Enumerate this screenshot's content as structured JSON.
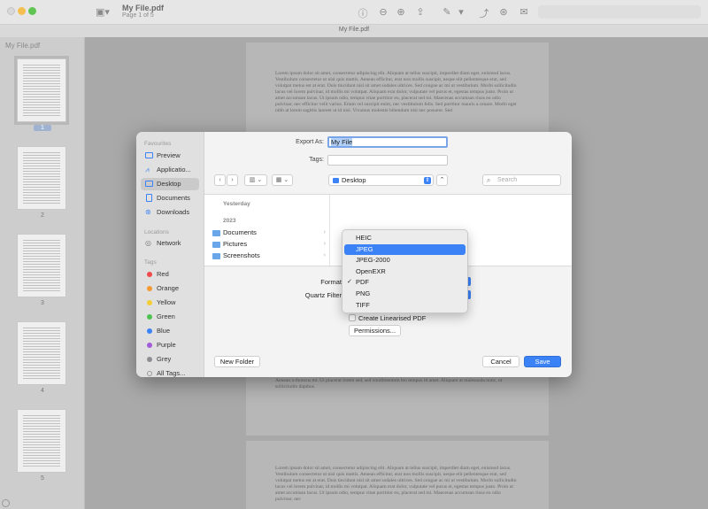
{
  "window": {
    "doc_title": "My File.pdf",
    "doc_subtitle": "Page 1 of 5",
    "tab_title": "My File.pdf"
  },
  "thumbnails": {
    "title": "My File.pdf",
    "pages": [
      "1",
      "2",
      "3",
      "4",
      "5"
    ]
  },
  "document": {
    "page1_text": "Lorem ipsum dolor sit amet, consectetur adipiscing elit. Aliquam at tellus suscipit, imperdiet diam eget, euismod lacus. Vestibulum consectetur ut nisl quis mattis. Aenean efficitur, erat non mollis suscipit, neque elit pellentesque erat, sed volutpat metus est at erat. Duis tincidunt nisl sit amet sodales ultrices. Sed congue ac mi ut vestibulum. Morbi sollicitudin lacus vel lorem pulvinar, id mollis mi volutpat. Aliquam erat dolor, vulputate vel purus et, egestas tempus justo. Proin ut amet accumsan lacus. Ut ipsum odio, tempus vitae porttitor eu, placerat sed mi. Maecenas accumsan risus eu odio pulvinar, nec efficitur velit varius. Etiam vel suscipit enim, nec vestibulum felis. Sed porttitor mauris a ornare. Morbi eget nibh at lorem sagittis laoreet ut id nisi. Vivamus molestie bibendum nisl nec posuere. Sed",
    "page1_lower_text": "Aenean a rhoncus mi. Ut placerat lorem sed, sed condimentum leo tempus id amet. Aliquam at malesuada nunc, ut sollicitudin dapibus.",
    "page2_text": "Lorem ipsum dolor sit amet, consectetur adipiscing elit. Aliquam at tellus suscipit, imperdiet diam eget, euismod lacus. Vestibulum consectetur ut nisl quis mattis. Aenean efficitur, erat non mollis suscipit, neque elit pellentesque erat, sed volutpat metus est at erat. Duis tincidunt nisl sit amet sodales ultrices. Sed congue ac mi ut vestibulum. Morbi sollicitudin lacus vel lorem pulvinar, id mollis mi volutpat. Aliquam erat dolor, vulputate vel purus et, egestas tempus justo. Proin ut amet accumsan lacus. Ut ipsum odio, tempus vitae porttitor eu, placerat sed mi. Maecenas accumsan risus eu odio pulvinar, nec"
  },
  "dialog": {
    "sidebar": {
      "favourites_heading": "Favourites",
      "favourites": [
        {
          "label": "Preview",
          "icon": "preview-icon"
        },
        {
          "label": "Applicatio...",
          "icon": "applications-icon"
        },
        {
          "label": "Desktop",
          "icon": "desktop-icon"
        },
        {
          "label": "Documents",
          "icon": "document-icon"
        },
        {
          "label": "Downloads",
          "icon": "download-icon"
        }
      ],
      "locations_heading": "Locations",
      "locations": [
        {
          "label": "Network",
          "icon": "network-icon"
        }
      ],
      "tags_heading": "Tags",
      "tags": [
        {
          "label": "Red",
          "color": "#f0494a"
        },
        {
          "label": "Orange",
          "color": "#f59a33"
        },
        {
          "label": "Yellow",
          "color": "#f4cc34"
        },
        {
          "label": "Green",
          "color": "#4cc350"
        },
        {
          "label": "Blue",
          "color": "#3b82f6"
        },
        {
          "label": "Purple",
          "color": "#a25bd9"
        },
        {
          "label": "Grey",
          "color": "#8e8e93"
        },
        {
          "label": "All Tags...",
          "color": ""
        }
      ]
    },
    "export_as_label": "Export As:",
    "export_as_value": "My File",
    "tags_label": "Tags:",
    "tags_value": "",
    "location": "Desktop",
    "search_placeholder": "Search",
    "browser": {
      "yesterday_heading": "Yesterday",
      "year_heading": "2023",
      "folders": [
        "Documents",
        "Pictures",
        "Screenshots"
      ]
    },
    "format_label": "Format",
    "quartz_filter_label": "Quartz Filter",
    "create_linearised_label": "Create Linearised PDF",
    "permissions_button": "Permissions...",
    "new_folder_button": "New Folder",
    "cancel_button": "Cancel",
    "save_button": "Save",
    "format_menu": {
      "items": [
        "HEIC",
        "JPEG",
        "JPEG-2000",
        "OpenEXR",
        "PDF",
        "PNG",
        "TIFF"
      ],
      "highlighted": "JPEG",
      "checked": "PDF"
    }
  },
  "colors": {
    "accent": "#3b82f6"
  }
}
